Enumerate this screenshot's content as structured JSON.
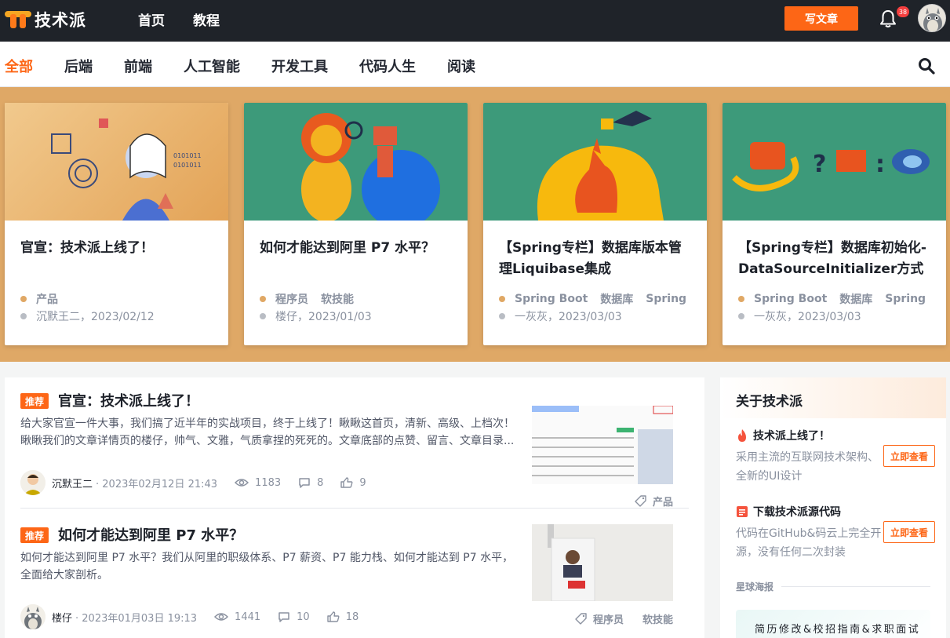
{
  "header": {
    "logo_text": "技术派",
    "nav": [
      "首页",
      "教程"
    ],
    "write_label": "写文章",
    "notification_count": "38"
  },
  "categories": [
    "全部",
    "后端",
    "前端",
    "人工智能",
    "开发工具",
    "代码人生",
    "阅读"
  ],
  "featured": [
    {
      "title": "官宣：技术派上线了！",
      "tags": [
        "产品"
      ],
      "author_date": "沉默王二，2023/02/12"
    },
    {
      "title": "如何才能达到阿里 P7 水平？",
      "tags": [
        "程序员",
        "软技能"
      ],
      "author_date": "楼仔，2023/01/03"
    },
    {
      "title": "【Spring专栏】数据库版本管理Liquibase集成",
      "tags": [
        "Spring Boot",
        "数据库",
        "Spring"
      ],
      "author_date": "一灰灰，2023/03/03"
    },
    {
      "title": "【Spring专栏】数据库初始化-DataSourceInitializer方式",
      "tags": [
        "Spring Boot",
        "数据库",
        "Spring"
      ],
      "author_date": "一灰灰，2023/03/03"
    }
  ],
  "posts": [
    {
      "badge": "推荐",
      "title": "官宣：技术派上线了！",
      "desc": "给大家官宣一件大事，我们搞了近半年的实战项目，终于上线了！瞅瞅这首页，清新、高级、上档次！瞅瞅我们的文章详情页的楼仔，帅气、文雅，气质拿捏的死死的。文章底部的点赞、留言、文章目录...",
      "author": "沉默王二",
      "time": "· 2023年02月12日 21:43",
      "views": "1183",
      "comments": "8",
      "likes": "9",
      "tags": [
        "产品"
      ]
    },
    {
      "badge": "推荐",
      "title": "如何才能达到阿里 P7 水平？",
      "desc": "如何才能达到阿里 P7 水平？我们从阿里的职级体系、P7 薪资、P7 能力栈、如何才能达到 P7 水平，全面给大家剖析。",
      "author": "楼仔",
      "time": "· 2023年01月03日 19:13",
      "views": "1441",
      "comments": "10",
      "likes": "18",
      "tags": [
        "程序员",
        "软技能"
      ]
    }
  ],
  "sidebar": {
    "title": "关于技术派",
    "items": [
      {
        "title": "技术派上线了！",
        "desc": "采用主流的互联网技术架构、全新的UI设计",
        "button": "立即查看"
      },
      {
        "title": "下载技术派源代码",
        "desc": "代码在GitHub&码云上完全开源，没有任何二次封装",
        "button": "立即查看"
      }
    ],
    "planet_label": "星球海报",
    "poster_text": "简历修改&校招指南&求职面试"
  },
  "colors": {
    "accent": "#fd6616",
    "hero_bg": "#dfa866",
    "topbar": "#1f2329"
  }
}
